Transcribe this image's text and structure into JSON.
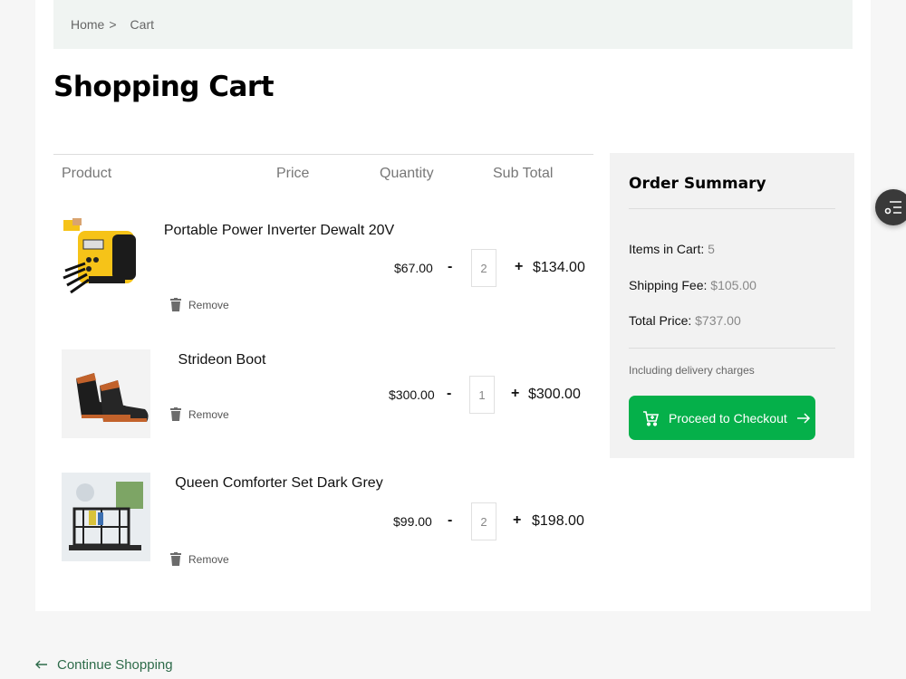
{
  "breadcrumb": {
    "home": "Home",
    "separator": ">",
    "current": "Cart"
  },
  "page_title": "Shopping Cart",
  "table": {
    "headers": {
      "product": "Product",
      "price": "Price",
      "quantity": "Quantity",
      "subtotal": "Sub Total"
    },
    "minus": "-",
    "plus": "+",
    "remove_label": "Remove",
    "items": [
      {
        "name": "Portable Power Inverter Dewalt 20V",
        "price": "$67.00",
        "qty": "2",
        "subtotal": "$134.00"
      },
      {
        "name": "Strideon Boot",
        "price": "$300.00",
        "qty": "1",
        "subtotal": "$300.00"
      },
      {
        "name": "Queen Comforter Set Dark Grey",
        "price": "$99.00",
        "qty": "2",
        "subtotal": "$198.00"
      }
    ]
  },
  "summary": {
    "title": "Order Summary",
    "items_label": "Items in Cart:",
    "items_value": "5",
    "shipping_label": "Shipping Fee:",
    "shipping_value": "$105.00",
    "total_label": "Total Price:",
    "total_value": "$737.00",
    "note": "Including delivery charges",
    "checkout_label": "Proceed to Checkout",
    "checkout_icon": "cart-icon",
    "button_color": "#05b04a"
  },
  "continue_label": "Continue Shopping",
  "floating_icon": "filter-list-icon"
}
